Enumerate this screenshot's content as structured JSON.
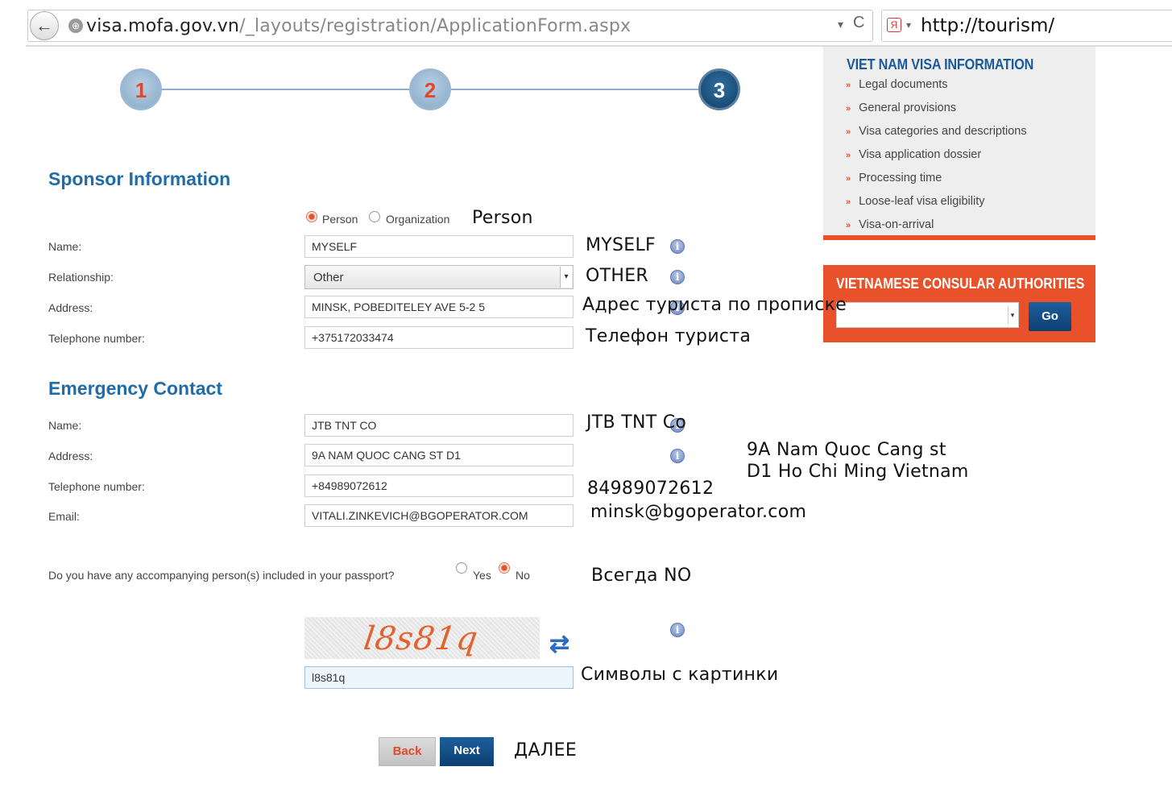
{
  "browser": {
    "url_host": "visa.mofa.gov.vn",
    "url_path": "/_layouts/registration/ApplicationForm.aspx",
    "search_text": "http://tourism/",
    "back_icon": "←",
    "globe_icon": "⊕",
    "reload_icon": "C",
    "yandex_icon": "Я",
    "dropdown_icon": "▾"
  },
  "steps": [
    "1",
    "2",
    "3"
  ],
  "sponsor": {
    "title": "Sponsor Information",
    "type_options": [
      "Person",
      "Organization"
    ],
    "selected_type": "Person",
    "name_label": "Name:",
    "name_value": "MYSELF",
    "relationship_label": "Relationship:",
    "relationship_value": "Other",
    "address_label": "Address:",
    "address_value": "MINSK, POBEDITELEY AVE 5-2 5",
    "phone_label": "Telephone number:",
    "phone_value": "+375172033474"
  },
  "emergency": {
    "title": "Emergency Contact",
    "name_label": "Name:",
    "name_value": "JTB TNT CO",
    "address_label": "Address:",
    "address_value": "9A NAM QUOC CANG ST D1",
    "phone_label": "Telephone number:",
    "phone_value": "+84989072612",
    "email_label": "Email:",
    "email_value": "VITALI.ZINKEVICH@BGOPERATOR.COM"
  },
  "accompanying": {
    "question": "Do you have any accompanying person(s) included in your passport?",
    "yes_label": "Yes",
    "no_label": "No",
    "selected": "No"
  },
  "captcha": {
    "image_text": "l8s81q",
    "input_value": "l8s81q",
    "refresh_icon": "⇄"
  },
  "buttons": {
    "back": "Back",
    "next": "Next"
  },
  "info_icon": "i",
  "sidebar": {
    "info_title": "VIET NAM VISA INFORMATION",
    "bullet": "»",
    "items": [
      "Legal documents",
      "General provisions",
      "Visa categories and descriptions",
      "Visa application dossier",
      "Processing time",
      "Loose-leaf visa eligibility",
      "Visa-on-arrival"
    ],
    "consul_title": "VIETNAMESE CONSULAR AUTHORITIES",
    "go_label": "Go"
  },
  "annotations": {
    "person": "Person",
    "myself": "MYSELF",
    "other": "OTHER",
    "address": "Адрес туриста по прописке",
    "phone": "Телефон туриста",
    "jtb": "JTB TNT Co",
    "ec_address_line1": "9A Nam Quoc Cang st",
    "ec_address_line2": "D1 Ho Chi Ming Vietnam",
    "ec_phone": "84989072612",
    "ec_email": "minsk@bgoperator.com",
    "always_no": "Всегда NO",
    "captcha_hint": "Символы с картинки",
    "next_hint": "ДАЛЕЕ"
  },
  "colors": {
    "accent_blue": "#1f6ca8",
    "accent_orange": "#e8512a",
    "navy": "#0d3f72"
  }
}
